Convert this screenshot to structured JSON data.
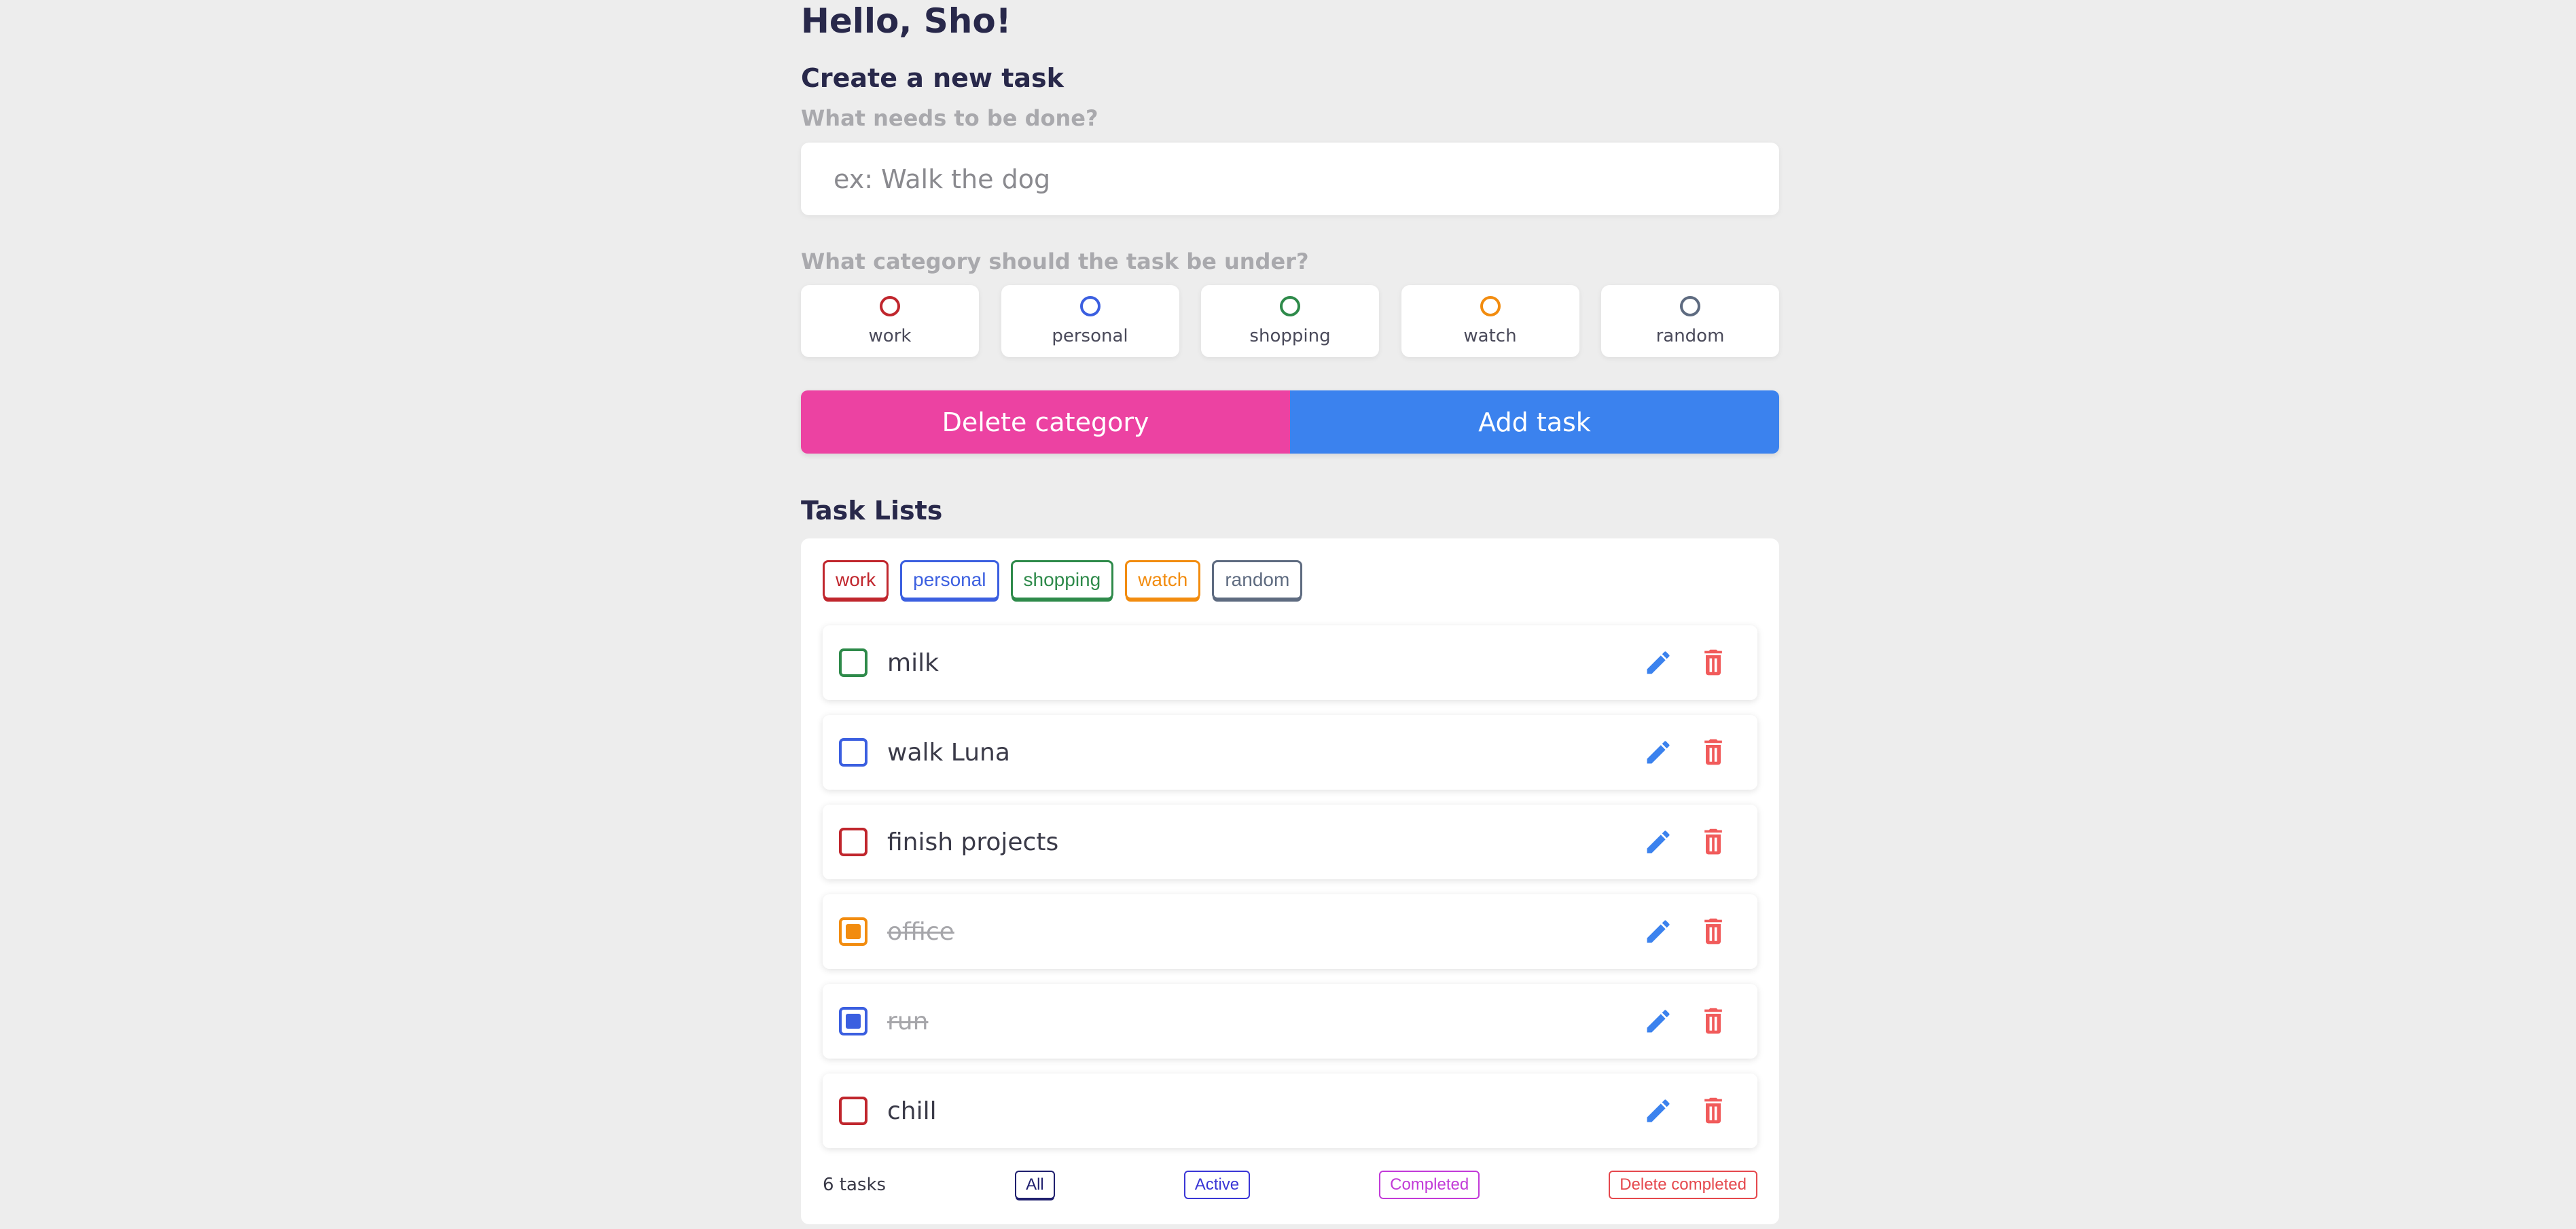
{
  "greeting": "Hello, Sho!",
  "create": {
    "heading": "Create a new task",
    "task_label": "What needs to be done?",
    "task_placeholder": "ex: Walk the dog",
    "task_value": "",
    "category_label": "What category should the task be under?"
  },
  "categories": [
    {
      "name": "work",
      "color": "#c0262d",
      "selected": false
    },
    {
      "name": "personal",
      "color": "#3b5fe0",
      "selected": false
    },
    {
      "name": "shopping",
      "color": "#2e8a4a",
      "selected": false
    },
    {
      "name": "watch",
      "color": "#f28c0f",
      "selected": false
    },
    {
      "name": "random",
      "color": "#5e6b80",
      "selected": false
    }
  ],
  "actions": {
    "delete_category": "Delete category",
    "add_task": "Add task"
  },
  "lists": {
    "heading": "Task Lists",
    "tags": [
      {
        "name": "work",
        "color": "#c0262d"
      },
      {
        "name": "personal",
        "color": "#3b5fe0"
      },
      {
        "name": "shopping",
        "color": "#2e8a4a"
      },
      {
        "name": "watch",
        "color": "#f28c0f"
      },
      {
        "name": "random",
        "color": "#5e6b80"
      }
    ],
    "tasks": [
      {
        "text": "milk",
        "category": "shopping",
        "color": "#2e8a4a",
        "completed": false,
        "edit_icon": "pencil-icon",
        "delete_icon": "trash-icon"
      },
      {
        "text": "walk Luna",
        "category": "personal",
        "color": "#3b5fe0",
        "completed": false,
        "edit_icon": "pencil-icon",
        "delete_icon": "trash-icon"
      },
      {
        "text": "finish projects",
        "category": "work",
        "color": "#c0262d",
        "completed": false,
        "edit_icon": "pencil-icon",
        "delete_icon": "trash-icon"
      },
      {
        "text": "office",
        "category": "watch",
        "color": "#f28c0f",
        "completed": true,
        "edit_icon": "pencil-icon",
        "delete_icon": "trash-icon"
      },
      {
        "text": "run",
        "category": "personal",
        "color": "#3b5fe0",
        "completed": true,
        "edit_icon": "pencil-icon",
        "delete_icon": "trash-icon"
      },
      {
        "text": "chill",
        "category": "work",
        "color": "#c0262d",
        "completed": false,
        "edit_icon": "pencil-icon",
        "delete_icon": "trash-icon"
      }
    ],
    "icon_colors": {
      "edit": "#3b82ee",
      "delete": "#f15b5b"
    },
    "footer": {
      "count": "6 tasks",
      "all": "All",
      "active": "Active",
      "completed": "Completed",
      "delete_completed": "Delete completed",
      "selected_filter": "All"
    }
  }
}
